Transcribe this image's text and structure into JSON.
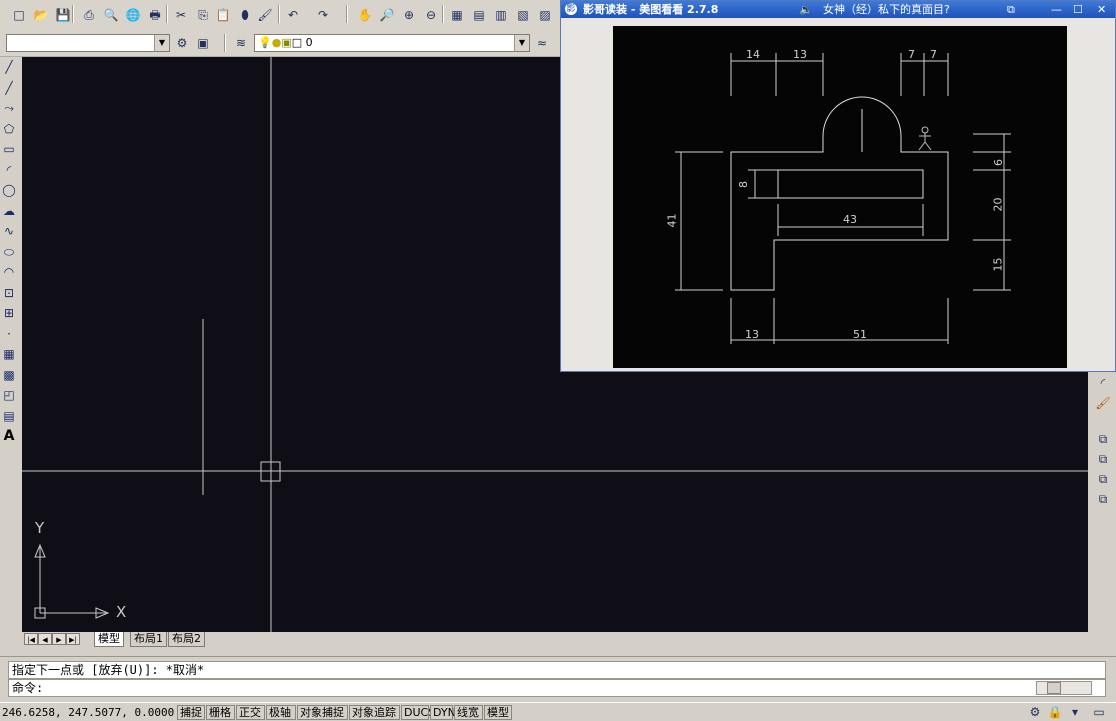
{
  "toolbar": {
    "layer_combo_value": "",
    "layer_name": "0",
    "row1_icons": [
      "new-icon",
      "open-icon",
      "save-icon",
      "print-icon",
      "preview-icon",
      "publish-icon",
      "plot-icon",
      "cut-icon",
      "copy-icon",
      "paste-icon",
      "match-icon",
      "brush-icon",
      "undo-icon",
      "redo-icon",
      "pan-icon",
      "zoom-realtime-icon",
      "zoom-window-icon",
      "zoom-prev-icon",
      "properties-icon",
      "design-center-icon",
      "tool-palette-icon",
      "sheet-set-icon",
      "markup-icon"
    ]
  },
  "draw_tools": [
    "line-icon",
    "construction-line-icon",
    "polyline-icon",
    "polygon-icon",
    "rectangle-icon",
    "arc-icon",
    "circle-icon",
    "revcloud-icon",
    "spline-icon",
    "ellipse-icon",
    "ellipse-arc-icon",
    "insert-block-icon",
    "make-block-icon",
    "point-icon",
    "hatch-icon",
    "gradient-icon",
    "region-icon",
    "table-icon",
    "mtext-icon"
  ],
  "draw_tool_glyphs": [
    "╱",
    "╱",
    "⤳",
    "⬠",
    "▭",
    "◜",
    "◯",
    "☁",
    "∿",
    "⬭",
    "◠",
    "⊡",
    "⊞",
    "·",
    "▦",
    "▩",
    "◰",
    "▤",
    "A"
  ],
  "ucs": {
    "x_label": "X",
    "y_label": "Y"
  },
  "layout_tabs": {
    "nav": [
      "|◀",
      "◀",
      "▶",
      "▶|"
    ],
    "tabs": [
      "模型",
      "布局1",
      "布局2"
    ]
  },
  "command": {
    "history": "指定下一点或 [放弃(U)]: *取消*",
    "prompt": "命令:"
  },
  "status": {
    "coords": "246.6258,  247.5077,  0.0000",
    "buttons": [
      "捕捉",
      "栅格",
      "正交",
      "极轴",
      "对象捕捉",
      "对象追踪",
      "DUCS",
      "DYN",
      "线宽",
      "模型"
    ]
  },
  "viewer": {
    "title": "影哥读装 - 美图看看 2.7.8",
    "media_text": "女神（经）私下的真面目?",
    "controls": [
      "⧉",
      "—",
      "☐",
      "✕"
    ]
  },
  "drawing": {
    "dimensions": [
      "14",
      "13",
      "7",
      "7",
      "6",
      "20",
      "15",
      "41",
      "8",
      "43",
      "13",
      "51"
    ]
  },
  "colors": {
    "canvas": "#0f0e16",
    "viewer_title": "#2a5fc6",
    "line": "#c8c8c8"
  }
}
